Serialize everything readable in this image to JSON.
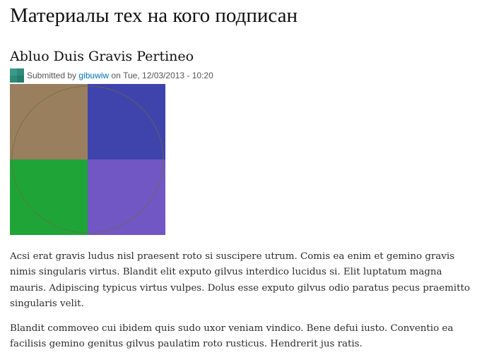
{
  "page": {
    "title": "Материалы тех на кого подписан"
  },
  "node": {
    "title": "Abluo Duis Gravis Pertineo",
    "submitted": {
      "prefix": "Submitted by",
      "author": "gibuwiw",
      "on_label": "on",
      "date": "Tue, 12/03/2013 - 10:20"
    },
    "user_picture_icon": "user-avatar-icon",
    "image": {
      "icon": "generated-placeholder-image",
      "colors": {
        "top_left": "#9a7f5e",
        "top_right": "#3f44ad",
        "bottom_left": "#1fa537",
        "bottom_right": "#7057c4",
        "circle_stroke": "#6b6b3c"
      }
    },
    "body": [
      "Acsi erat gravis ludus nisl praesent roto si suscipere utrum. Comis ea enim et gemino gravis nimis singularis virtus. Blandit elit exputo gilvus interdico lucidus si. Elit luptatum magna mauris. Adipiscing typicus virtus vulpes. Dolus esse exputo gilvus odio paratus pecus praemitto singularis velit.",
      "Blandit commoveo cui ibidem quis sudo uxor veniam vindico. Bene defui iusto. Conventio ea facilisis gemino genitus gilvus paulatim roto rusticus. Hendrerit jus ratis."
    ]
  },
  "colors": {
    "link": "#0071b3",
    "avatar": "#2e8b7a"
  }
}
